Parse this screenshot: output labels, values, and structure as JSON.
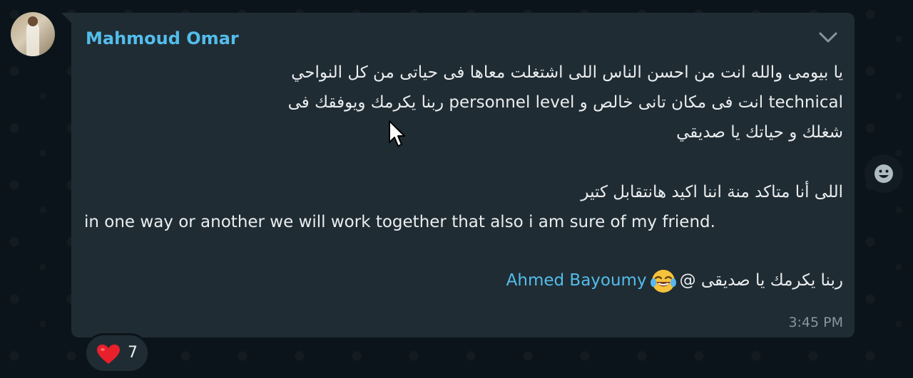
{
  "message": {
    "sender": "Mahmoud Omar",
    "lines": [
      "يا بيومى والله انت من احسن الناس اللى اشتغلت معاها فى حياتى من كل النواحي",
      "technical انت فى مكان تانى خالص و personnel level ربنا يكرمك ويوفقك فى",
      "شغلك و حياتك يا صديقي",
      "اللى أنا متاكد منة  اننا اكيد هانتقابل كتير",
      "in one way or another we will work together that also i am sure of my friend."
    ],
    "last_line": {
      "text": "ربنا يكرمك يا صديقى @",
      "emoji": "face-with-tears-of-joy",
      "mention": "Ahmed Bayoumy"
    },
    "time": "3:45 PM"
  },
  "reaction": {
    "emoji": "red-heart",
    "count": "7"
  },
  "colors": {
    "background": "#0b141a",
    "bubble": "#202c33",
    "sender": "#53bdeb",
    "text": "#e9edef",
    "meta": "#8696a0"
  }
}
